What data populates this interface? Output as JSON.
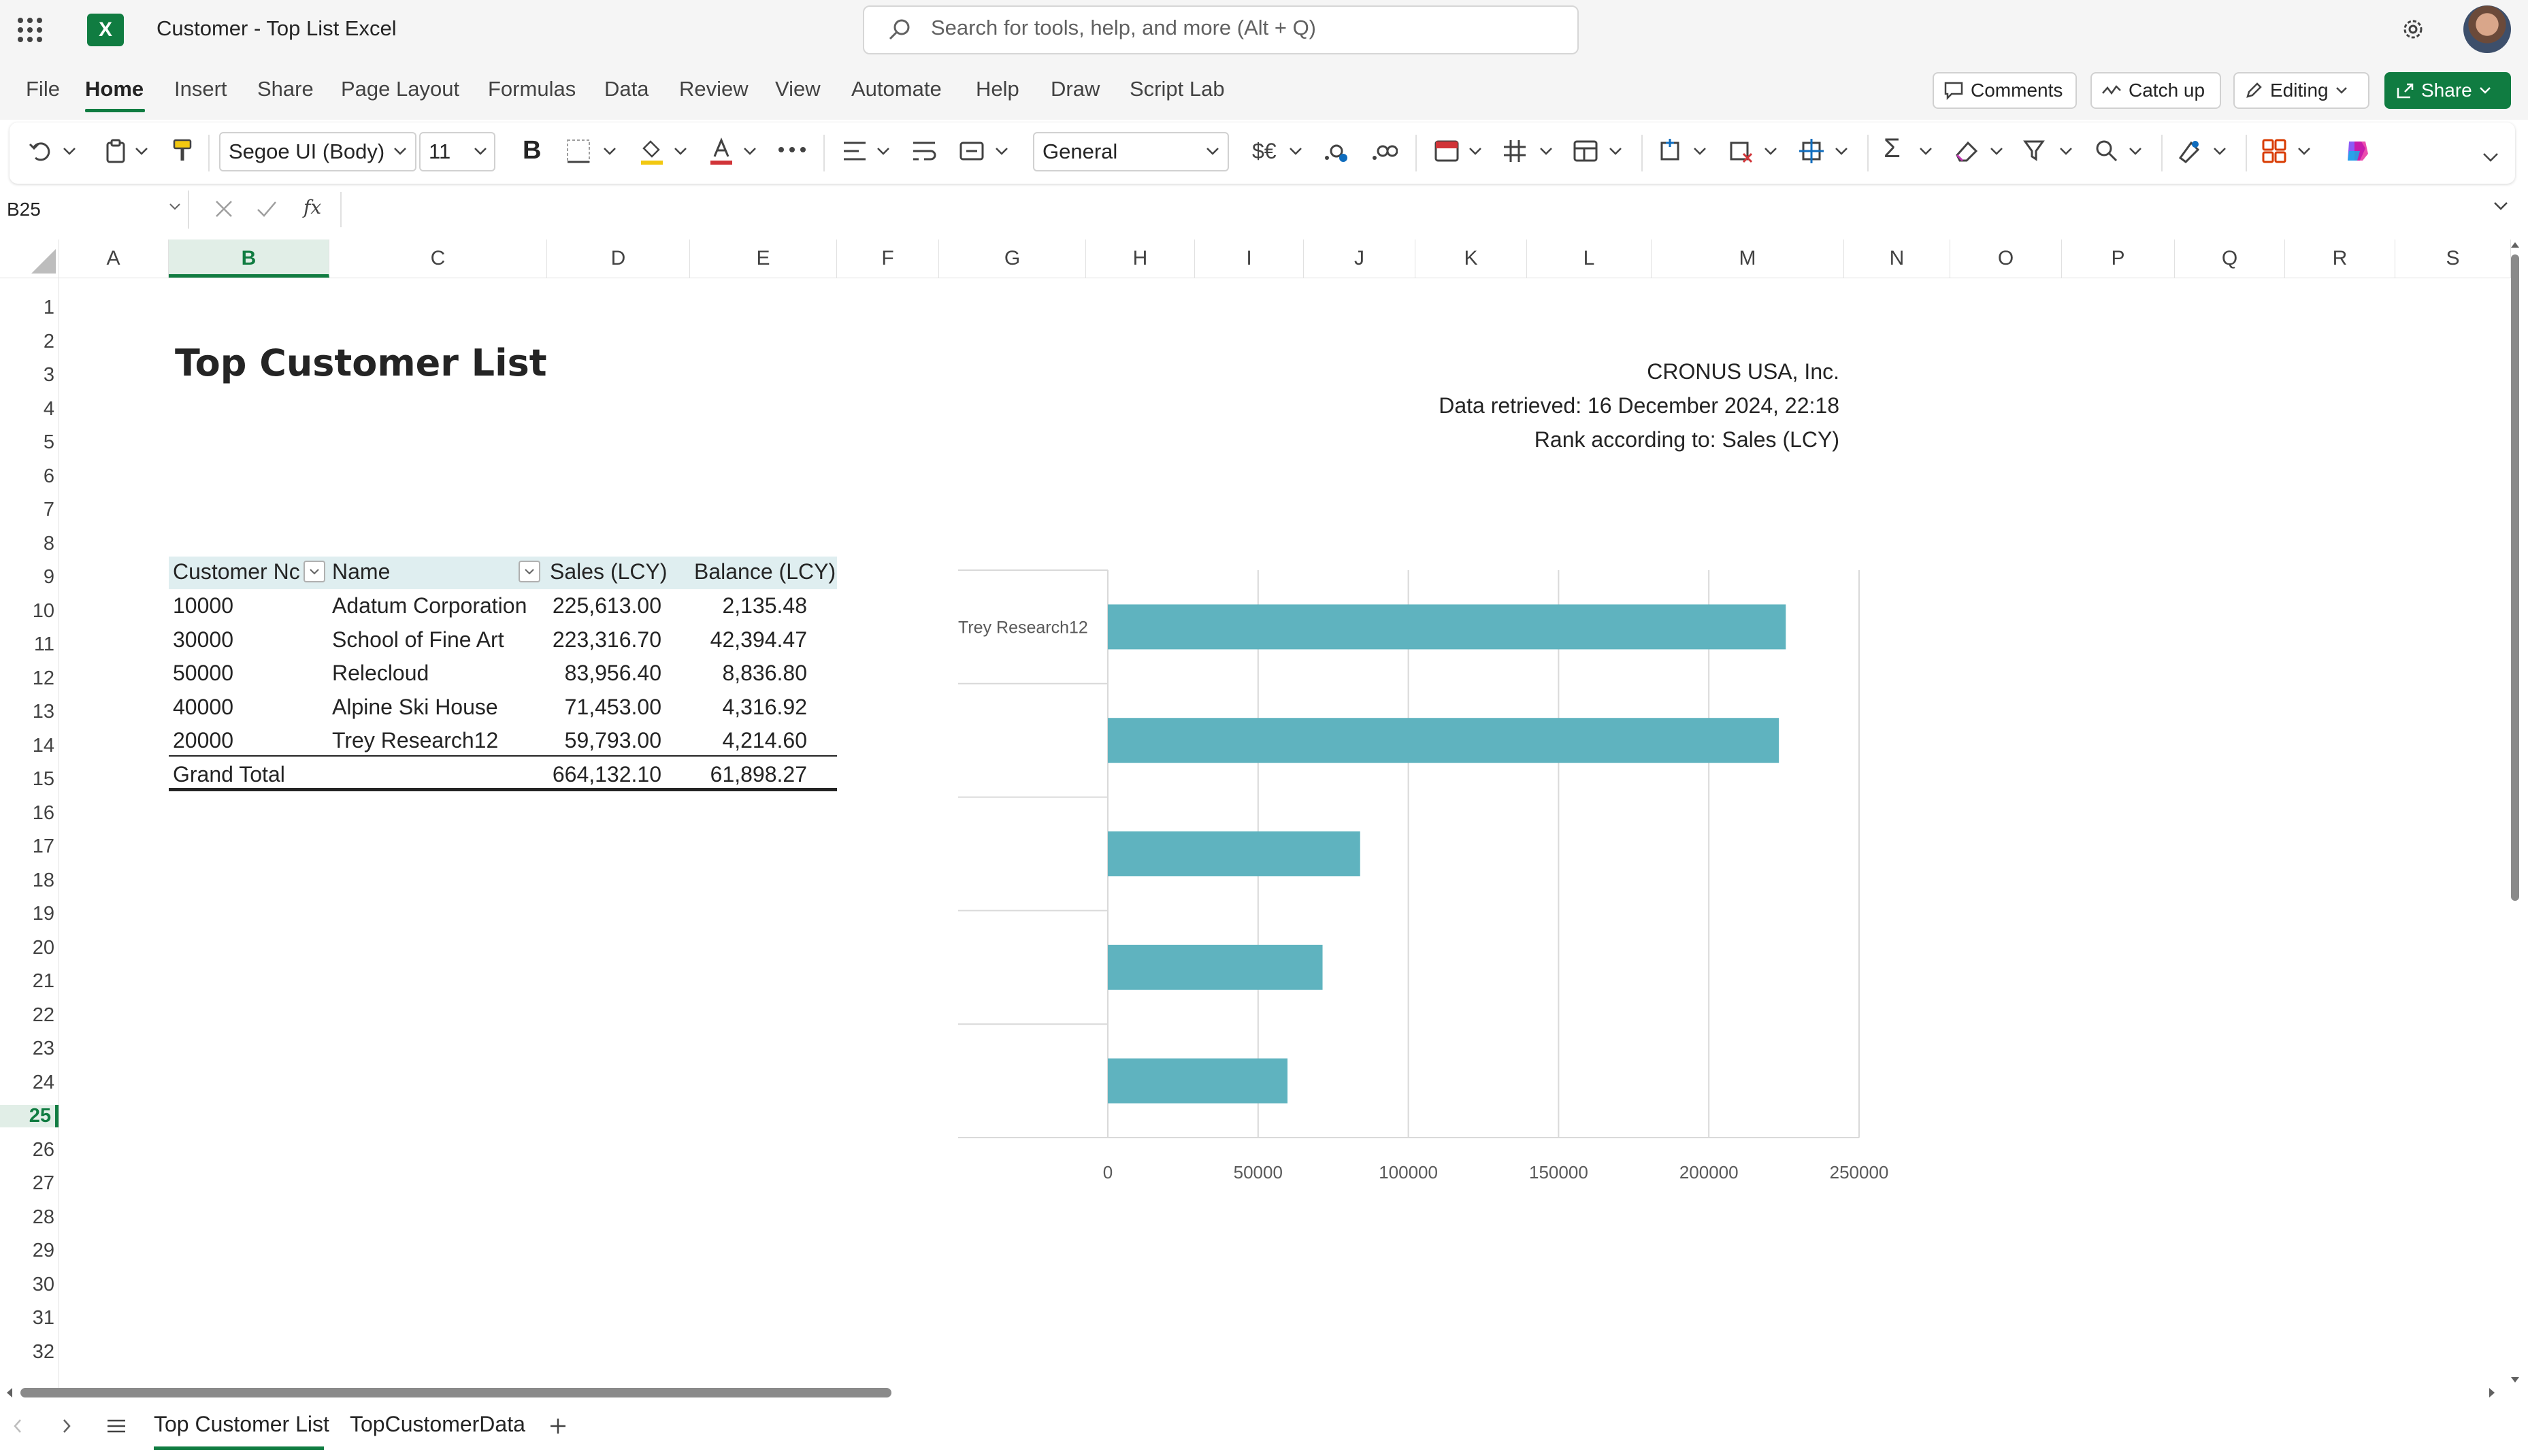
{
  "app": {
    "logo_text": "X",
    "title": "Customer - Top List Excel",
    "search_placeholder": "Search for tools, help, and more (Alt + Q)"
  },
  "menu": {
    "items": [
      "File",
      "Home",
      "Insert",
      "Share",
      "Page Layout",
      "Formulas",
      "Data",
      "Review",
      "View",
      "Automate",
      "Help",
      "Draw",
      "Script Lab"
    ],
    "active": "Home",
    "comments_label": "Comments",
    "catchup_label": "Catch up",
    "editing_label": "Editing",
    "share_label": "Share"
  },
  "ribbon": {
    "font_name": "Segoe UI (Body)",
    "font_size": "11",
    "bold_label": "B",
    "number_format": "General",
    "currency_label": "$€",
    "sum_label": "Σ"
  },
  "formula_bar": {
    "name_box": "B25",
    "fx_label": "fx",
    "value": ""
  },
  "grid": {
    "columns": [
      "A",
      "B",
      "C",
      "D",
      "E",
      "F",
      "G",
      "H",
      "I",
      "J",
      "K",
      "L",
      "M",
      "N",
      "O",
      "P",
      "Q",
      "R",
      "S"
    ],
    "rows": [
      "1",
      "2",
      "3",
      "4",
      "5",
      "6",
      "7",
      "8",
      "9",
      "10",
      "11",
      "12",
      "13",
      "14",
      "15",
      "16",
      "17",
      "18",
      "19",
      "20",
      "21",
      "22",
      "23",
      "24",
      "25",
      "26",
      "27",
      "28",
      "29",
      "30",
      "31",
      "32"
    ],
    "selected_column": "B",
    "selected_row": "25"
  },
  "sheet": {
    "title": "Top Customer List",
    "company": "CRONUS USA, Inc.",
    "retrieved": "Data retrieved: 16 December 2024, 22:18",
    "rank": "Rank according to: Sales (LCY)",
    "table": {
      "headers": [
        "Customer Nc",
        "Name",
        "Sales (LCY)",
        "Balance (LCY)"
      ],
      "rows": [
        [
          "10000",
          "Adatum Corporation",
          "225,613.00",
          "2,135.48"
        ],
        [
          "30000",
          "School of Fine Art",
          "223,316.70",
          "42,394.47"
        ],
        [
          "50000",
          "Relecloud",
          "83,956.40",
          "8,836.80"
        ],
        [
          "40000",
          "Alpine Ski House",
          "71,453.00",
          "4,316.92"
        ],
        [
          "20000",
          "Trey Research12",
          "59,793.00",
          "4,214.60"
        ]
      ],
      "total": [
        "Grand Total",
        "",
        "664,132.10",
        "61,898.27"
      ]
    }
  },
  "chart_data": {
    "type": "bar",
    "orientation": "horizontal",
    "categories": [
      "Trey Research12",
      "",
      "",
      "",
      ""
    ],
    "values": [
      225613,
      223316.7,
      83956.4,
      71453,
      59793
    ],
    "xlim": [
      0,
      250000
    ],
    "xticks": [
      "0",
      "50000",
      "100000",
      "150000",
      "200000",
      "250000"
    ],
    "grid": true,
    "bar_color": "#5fb3bf"
  },
  "sheets": {
    "tabs": [
      "Top Customer List",
      "TopCustomerData"
    ],
    "active": "Top Customer List"
  },
  "colors": {
    "accent": "#107c41",
    "table_header": "#dfeef0"
  }
}
